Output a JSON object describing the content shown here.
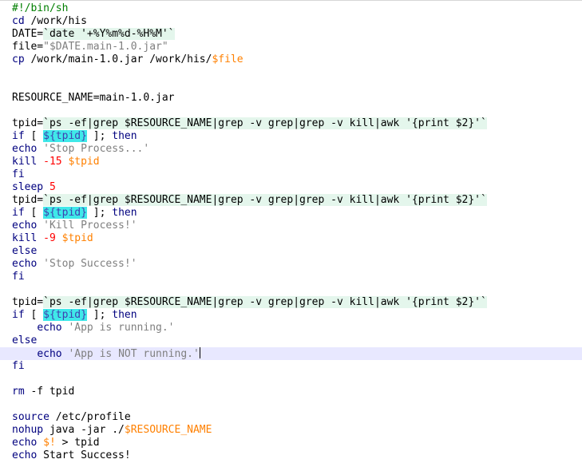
{
  "editor": {
    "lines": [
      [
        [
          "cmt",
          "#!/bin/sh"
        ]
      ],
      [
        [
          "kw",
          "cd"
        ],
        [
          "",
          " /work/his"
        ]
      ],
      [
        [
          "",
          "DATE="
        ],
        [
          "bt",
          "`date '+%Y%m%d-%H%M'`"
        ]
      ],
      [
        [
          "",
          "file="
        ],
        [
          "str",
          "\"$DATE.main-1.0.jar\""
        ]
      ],
      [
        [
          "kw",
          "cp"
        ],
        [
          "",
          " /work/main-1.0.jar /work/his/"
        ],
        [
          "vr",
          "$file"
        ]
      ],
      [],
      [],
      [
        [
          "",
          "RESOURCE_NAME=main-1.0.jar"
        ]
      ],
      [],
      [
        [
          "",
          "tpid="
        ],
        [
          "bt",
          "`ps -ef|grep $RESOURCE_NAME|grep -v grep|grep -v kill|awk '{print $2}'`"
        ]
      ],
      [
        [
          "kw",
          "if"
        ],
        [
          "",
          " [ "
        ],
        [
          "hl",
          "${tpid}"
        ],
        [
          "",
          " ]; "
        ],
        [
          "kw",
          "then"
        ]
      ],
      [
        [
          "kw",
          "echo"
        ],
        [
          "",
          " "
        ],
        [
          "str",
          "'Stop Process...'"
        ]
      ],
      [
        [
          "kw",
          "kill"
        ],
        [
          "",
          " "
        ],
        [
          "num",
          "-15"
        ],
        [
          "",
          " "
        ],
        [
          "vr",
          "$tpid"
        ]
      ],
      [
        [
          "kw",
          "fi"
        ]
      ],
      [
        [
          "kw",
          "sleep"
        ],
        [
          "",
          " "
        ],
        [
          "num",
          "5"
        ]
      ],
      [
        [
          "",
          "tpid="
        ],
        [
          "bt",
          "`ps -ef|grep $RESOURCE_NAME|grep -v grep|grep -v kill|awk '{print $2}'`"
        ]
      ],
      [
        [
          "kw",
          "if"
        ],
        [
          "",
          " [ "
        ],
        [
          "hl",
          "${tpid}"
        ],
        [
          "",
          " ]; "
        ],
        [
          "kw",
          "then"
        ]
      ],
      [
        [
          "kw",
          "echo"
        ],
        [
          "",
          " "
        ],
        [
          "str",
          "'Kill Process!'"
        ]
      ],
      [
        [
          "kw",
          "kill"
        ],
        [
          "",
          " "
        ],
        [
          "num",
          "-9"
        ],
        [
          "",
          " "
        ],
        [
          "vr",
          "$tpid"
        ]
      ],
      [
        [
          "kw",
          "else"
        ]
      ],
      [
        [
          "kw",
          "echo"
        ],
        [
          "",
          " "
        ],
        [
          "str",
          "'Stop Success!'"
        ]
      ],
      [
        [
          "kw",
          "fi"
        ]
      ],
      [],
      [
        [
          "",
          "tpid="
        ],
        [
          "bt",
          "`ps -ef|grep $RESOURCE_NAME|grep -v grep|grep -v kill|awk '{print $2}'`"
        ]
      ],
      [
        [
          "kw",
          "if"
        ],
        [
          "",
          " [ "
        ],
        [
          "hl",
          "${tpid}"
        ],
        [
          "",
          " ]; "
        ],
        [
          "kw",
          "then"
        ]
      ],
      [
        [
          "",
          "    "
        ],
        [
          "kw",
          "echo"
        ],
        [
          "",
          " "
        ],
        [
          "str",
          "'App is running.'"
        ]
      ],
      [
        [
          "kw",
          "else"
        ]
      ],
      [
        [
          "",
          "    "
        ],
        [
          "kw",
          "echo"
        ],
        [
          "",
          " "
        ],
        [
          "str",
          "'App is NOT running.'"
        ]
      ],
      [
        [
          "kw",
          "fi"
        ]
      ],
      [],
      [
        [
          "kw",
          "rm"
        ],
        [
          "",
          " -f tpid"
        ]
      ],
      [],
      [
        [
          "kw",
          "source"
        ],
        [
          "",
          " /etc/profile"
        ]
      ],
      [
        [
          "kw",
          "nohup"
        ],
        [
          "",
          " java -jar ./"
        ],
        [
          "vr",
          "$RESOURCE_NAME"
        ]
      ],
      [
        [
          "kw",
          "echo"
        ],
        [
          "",
          " "
        ],
        [
          "vr",
          "$!"
        ],
        [
          "",
          " > tpid"
        ]
      ],
      [
        [
          "kw",
          "echo"
        ],
        [
          "",
          " Start Success!"
        ]
      ]
    ]
  }
}
